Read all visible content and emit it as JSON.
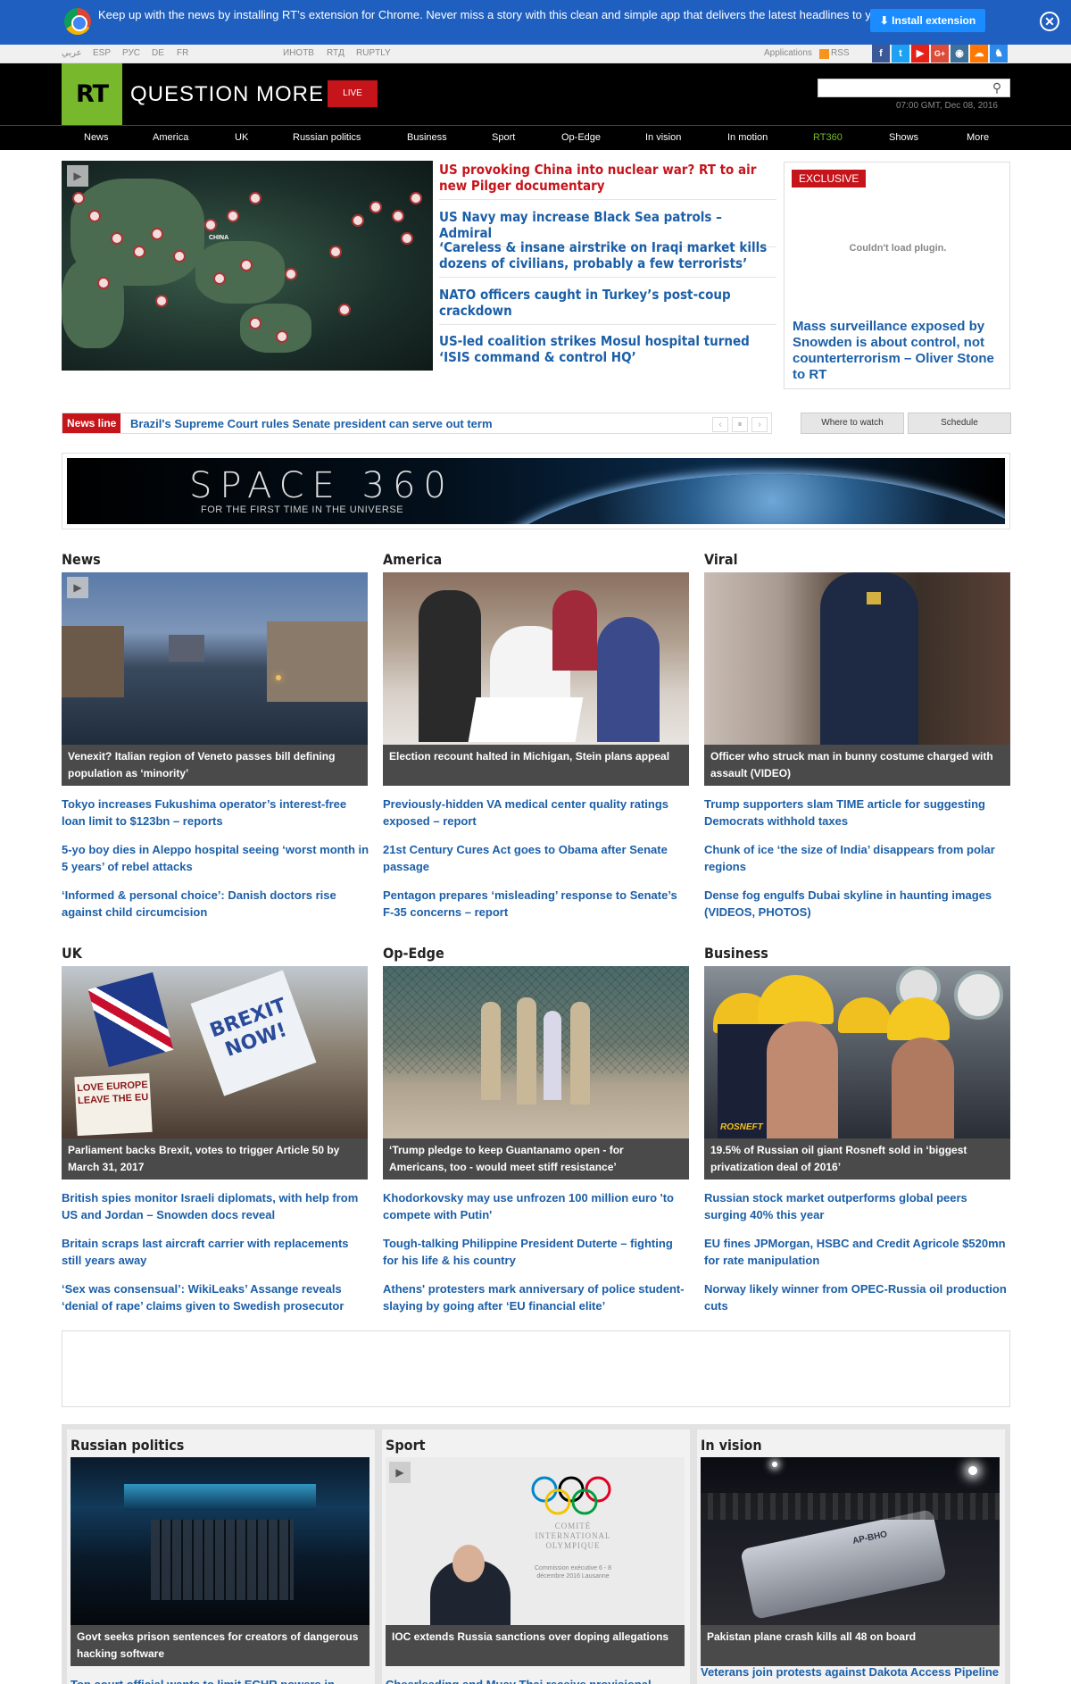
{
  "extension_bar": {
    "message": "Keep up with the news by installing RT’s extension for Chrome. Never miss a story with this clean and simple app that delivers the latest headlines to you.",
    "install_label": "⬇ Install extension",
    "close_label": "✕"
  },
  "topline": {
    "languages": [
      "عربي",
      "ESP",
      "РУС",
      "DE",
      "FR"
    ],
    "projects": [
      "ИНОТВ",
      "RTД",
      "RUPTLY"
    ],
    "applications": "Applications",
    "rss": "RSS",
    "social": [
      "f",
      "t",
      "▶",
      "G+",
      "◉",
      "☁",
      "♞"
    ]
  },
  "header": {
    "logo": "RT",
    "slogan": "QUESTION MORE",
    "live": "LIVE",
    "search_placeholder": "",
    "time": "07:00 GMT, Dec 08, 2016"
  },
  "nav": [
    "News",
    "America",
    "UK",
    "Russian politics",
    "Business",
    "Sport",
    "Op-Edge",
    "In vision",
    "In motion",
    "RT360",
    "Shows",
    "More"
  ],
  "top_stories": [
    "US provoking China into nuclear war? RT to air new Pilger documentary",
    "US Navy may increase Black Sea patrols – Admiral",
    "‘Careless & insane airstrike on Iraqi market kills dozens of civilians, probably a few terrorists’",
    "NATO officers caught in Turkey’s post-coup crackdown",
    "US-led coalition strikes Mosul hospital turned ‘ISIS command & control HQ’"
  ],
  "map_label": "CHINA",
  "exclusive": {
    "label": "EXCLUSIVE",
    "plugin": "Couldn't load plugin.",
    "title": "Mass surveillance exposed by Snowden is about control, not counterterrorism – Oliver Stone to RT"
  },
  "newsline": {
    "label": "News line",
    "text": "Brazil's Supreme Court rules Senate president can serve out term",
    "prev": "‹",
    "pause": "⏸",
    "next": "›",
    "where_to_watch": "Where to watch",
    "schedule": "Schedule"
  },
  "banner": {
    "title": "SPACE 360",
    "subtitle": "FOR THE FIRST TIME IN THE UNIVERSE"
  },
  "sections": [
    {
      "title": "News",
      "caption": "Venexit? Italian region of Veneto passes bill defining population as ‘minority’",
      "links": [
        "Tokyo increases Fukushima operator’s interest-free loan limit to $123bn – reports",
        "5-yo boy dies in Aleppo hospital seeing ‘worst month in 5 years’ of rebel attacks",
        "‘Informed & personal choice’: Danish doctors rise against child circumcision"
      ]
    },
    {
      "title": "America",
      "caption": "Election recount halted in Michigan, Stein plans appeal",
      "links": [
        "Previously-hidden VA medical center quality ratings exposed – report",
        "21st Century Cures Act goes to Obama after Senate passage",
        "Pentagon prepares ‘misleading’ response to Senate’s F-35 concerns – report"
      ]
    },
    {
      "title": "Viral",
      "caption": "Officer who struck man in bunny costume charged with assault (VIDEO)",
      "links": [
        "Trump supporters slam TIME article for suggesting Democrats withhold taxes",
        "Chunk of ice ‘the size of India’ disappears from polar regions",
        "Dense fog engulfs Dubai skyline in haunting images (VIDEOS, PHOTOS)"
      ]
    },
    {
      "title": "UK",
      "caption": "Parliament backs Brexit, votes to trigger Article 50 by March 31, 2017",
      "links": [
        "British spies monitor Israeli diplomats, with help from US and Jordan – Snowden docs reveal",
        "Britain scraps last aircraft carrier with replacements still years away",
        "‘Sex was consensual’: WikiLeaks’ Assange reveals ‘denial of rape’ claims given to Swedish prosecutor"
      ]
    },
    {
      "title": "Op-Edge",
      "caption": "‘Trump pledge to keep Guantanamo open - for Americans, too - would meet stiff resistance’",
      "links": [
        "Khodorkovsky may use unfrozen 100 million euro 'to compete with Putin'",
        "Tough-talking Philippine President Duterte – fighting for his life & his country",
        "Athens' protesters mark anniversary of police student-slaying by going after ‘EU financial elite’"
      ]
    },
    {
      "title": "Business",
      "caption": "19.5% of Russian oil giant Rosneft sold in ‘biggest privatization deal of 2016’",
      "links": [
        "Russian stock market outperforms global peers surging 40% this year",
        "EU fines JPMorgan, HSBC and Credit Agricole $520mn for rate manipulation",
        "Norway likely winner from OPEC-Russia oil production cuts"
      ]
    }
  ],
  "photo_text": {
    "brexit_sign": "BREXIT NOW!",
    "love_sign": "LOVE EUROPE LEAVE THE EU",
    "rosneft": "ROSNEFT",
    "ioc_name": "COMITÉ INTERNATIONAL OLYMPIQUE",
    "ioc_sub": "Commission exécutive 6 - 8 décembre 2016 Lausanne",
    "plane_text": "AP-BHO"
  },
  "bottom_sections": [
    {
      "title": "Russian politics",
      "caption": "Govt seeks prison sentences for creators of dangerous hacking software",
      "link": "Top court official wants to limit ECHR powers in"
    },
    {
      "title": "Sport",
      "caption": "IOC extends Russia sanctions over doping allegations",
      "link": "Cheerleading and Muay Thai receive provisional"
    },
    {
      "title": "In vision",
      "caption": "Pakistan plane crash kills all 48 on board",
      "link": "Veterans join protests against Dakota Access Pipeline"
    }
  ],
  "colors": {
    "brand_green": "#77b82c",
    "accent_red": "#c5151b",
    "link_blue": "#1b5fa8",
    "ext_bar_blue": "#1f5fbf"
  }
}
